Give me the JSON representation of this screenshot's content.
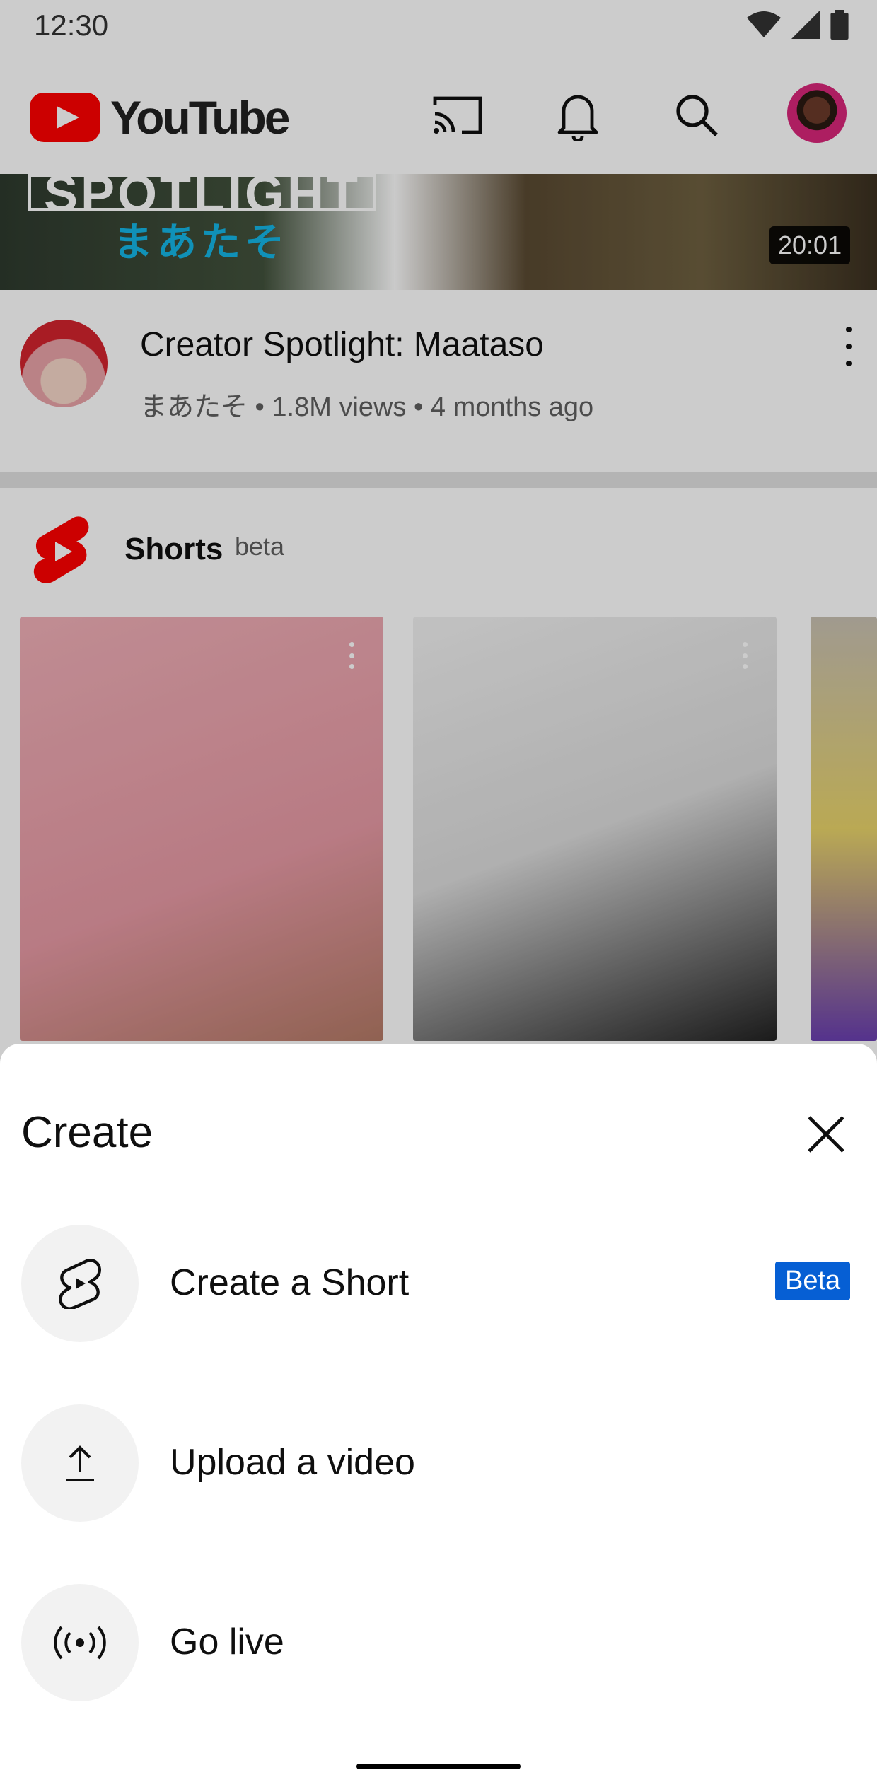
{
  "status_bar": {
    "time": "12:30"
  },
  "app_bar": {
    "logo_text": "YouTube",
    "icons": [
      "cast-icon",
      "notifications-icon",
      "search-icon",
      "account-avatar"
    ]
  },
  "feed": {
    "video": {
      "thumbnail_title": "SPOTLIGHT",
      "thumbnail_subtitle": "まあたそ",
      "duration": "20:01",
      "title": "Creator Spotlight: Maataso",
      "meta": "まあたそ • 1.8M views • 4 months ago"
    },
    "shorts": {
      "label": "Shorts",
      "tag": "beta"
    }
  },
  "create_sheet": {
    "title": "Create",
    "items": [
      {
        "label": "Create a Short",
        "icon": "shorts-icon",
        "badge": "Beta"
      },
      {
        "label": "Upload a video",
        "icon": "upload-icon"
      },
      {
        "label": "Go live",
        "icon": "live-icon"
      }
    ]
  },
  "colors": {
    "brand_red": "#ff0000",
    "badge_blue": "#065fd4",
    "scrim": "rgba(0,0,0,0.2)"
  }
}
